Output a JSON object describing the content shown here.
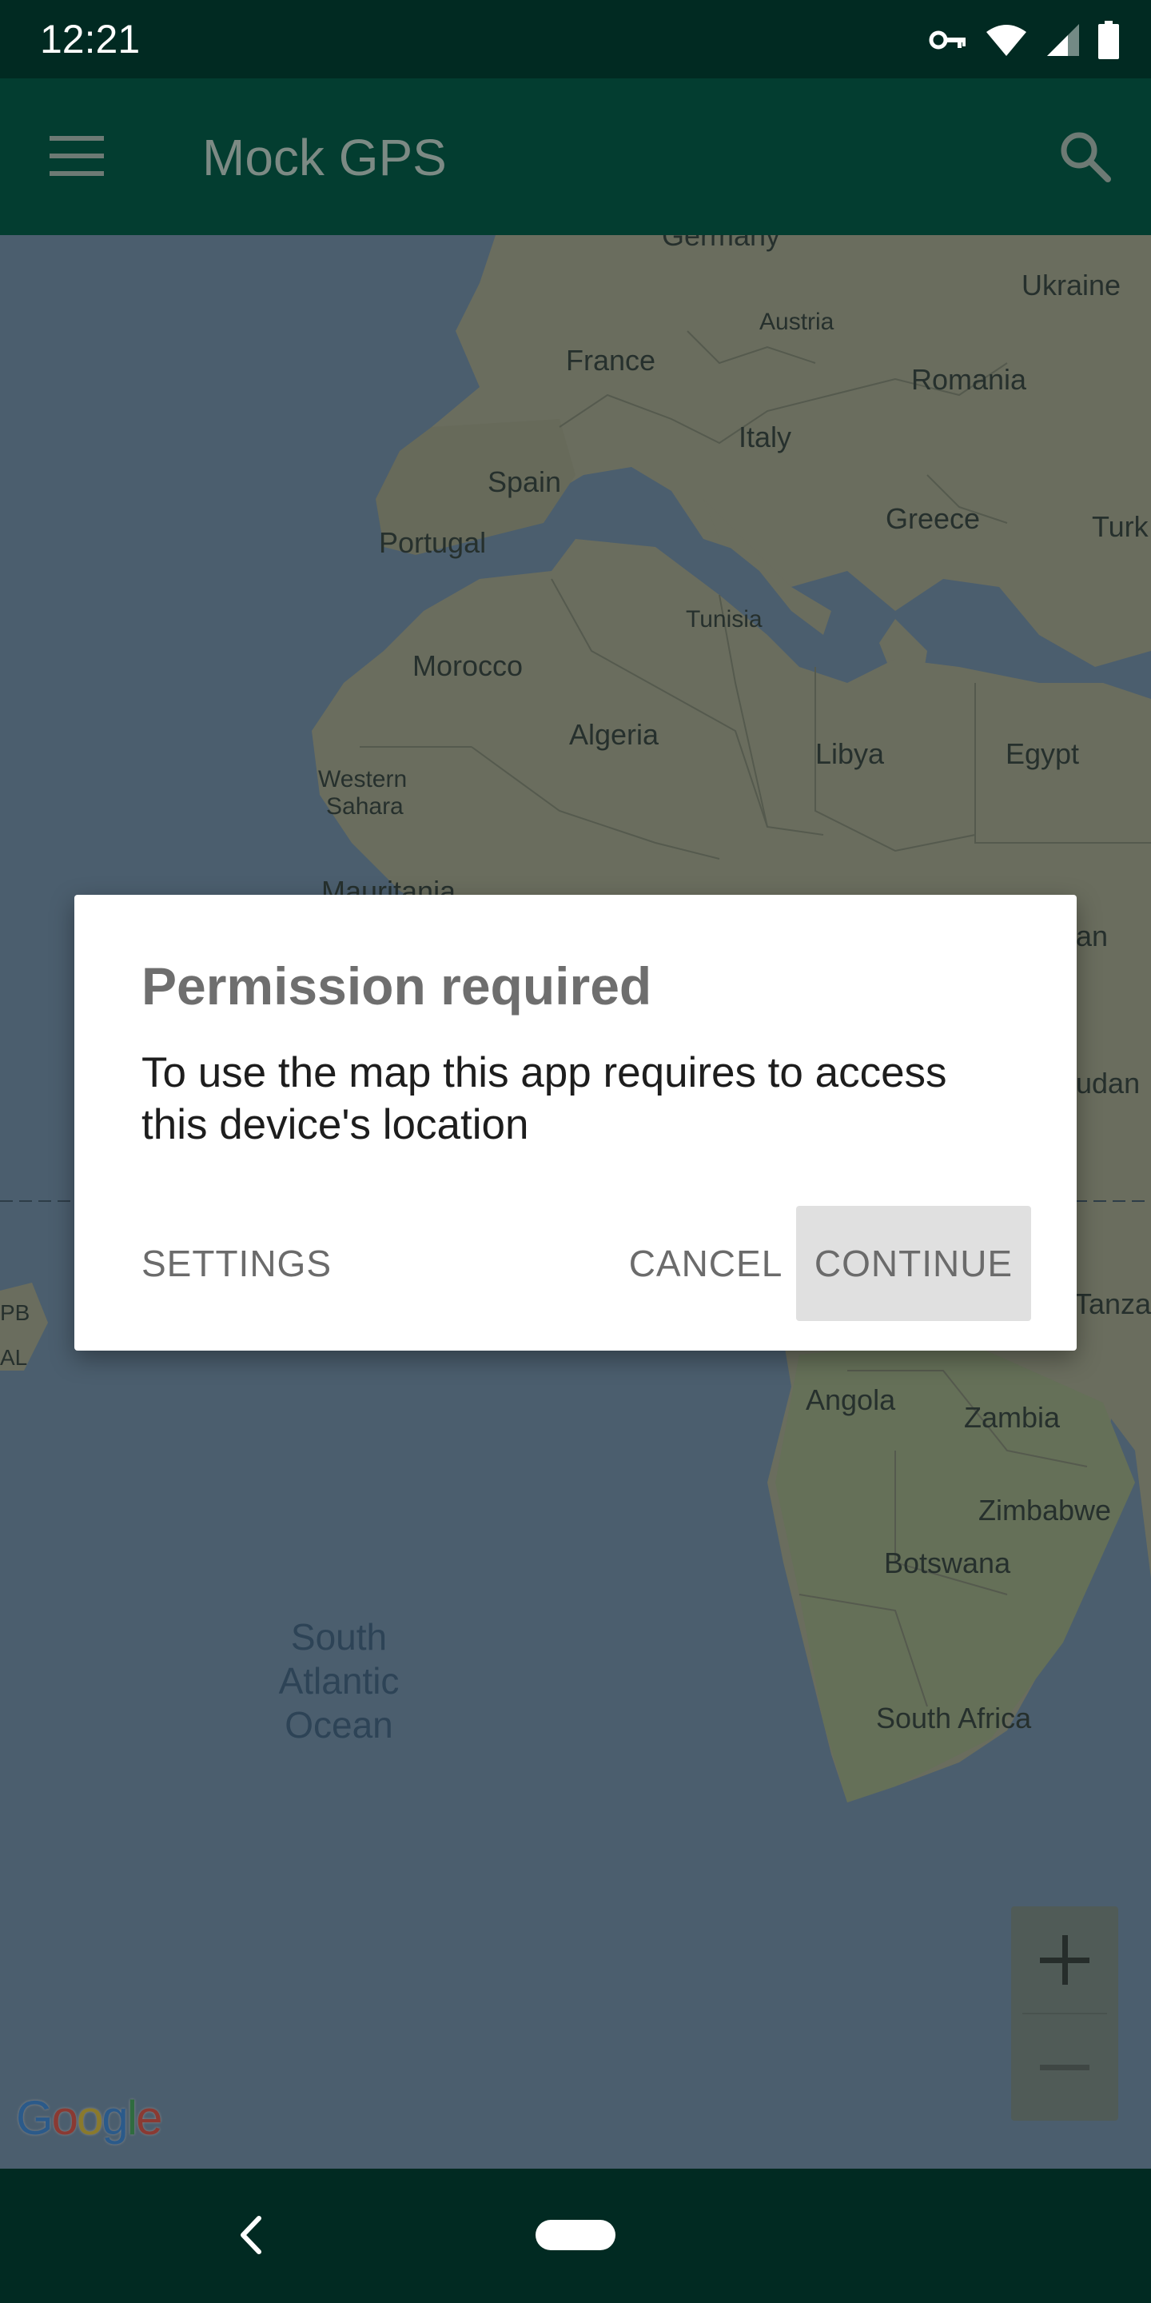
{
  "status_bar": {
    "time": "12:21",
    "icons": [
      "vpn-key-icon",
      "wifi-icon",
      "signal-icon",
      "battery-icon"
    ]
  },
  "app_bar": {
    "title": "Mock GPS",
    "menu_icon": "hamburger-menu-icon",
    "search_icon": "search-icon"
  },
  "map": {
    "labels": {
      "germany": "Germany",
      "ukraine": "Ukraine",
      "austria": "Austria",
      "france": "France",
      "romania": "Romania",
      "italy": "Italy",
      "spain": "Spain",
      "greece": "Greece",
      "turkey": "Turk",
      "portugal": "Portugal",
      "tunisia": "Tunisia",
      "morocco": "Morocco",
      "algeria": "Algeria",
      "libya": "Libya",
      "egypt": "Egypt",
      "western_sahara_1": "Western",
      "western_sahara_2": "Sahara",
      "mauritania": "Mauritania",
      "sudan_partial_1": "an",
      "sudan_partial_2": "udan",
      "tanzania_partial": "Tanza",
      "pb": "PB",
      "al": "AL",
      "angola": "Angola",
      "zambia": "Zambia",
      "zimbabwe": "Zimbabwe",
      "botswana": "Botswana",
      "south_africa": "South Africa"
    },
    "ocean": {
      "line1": "South",
      "line2": "Atlantic",
      "line3": "Ocean"
    },
    "zoom_in": "+",
    "zoom_out": "−",
    "attribution": "Google"
  },
  "dialog": {
    "title": "Permission required",
    "message": "To use the map this app requires to access this device's location",
    "buttons": {
      "settings": "SETTINGS",
      "cancel": "CANCEL",
      "continue": "CONTINUE"
    }
  },
  "colors": {
    "status_bar": "#012a22",
    "app_bar": "#033d30",
    "ocean_dimmed": "#4b5e6e",
    "land_dimmed": "#6a6d5e",
    "dialog_bg": "#ffffff",
    "continue_highlight": "#e0e0e0"
  },
  "nav_bar": {
    "back_icon": "back-chevron-icon",
    "home_icon": "home-pill-icon"
  }
}
